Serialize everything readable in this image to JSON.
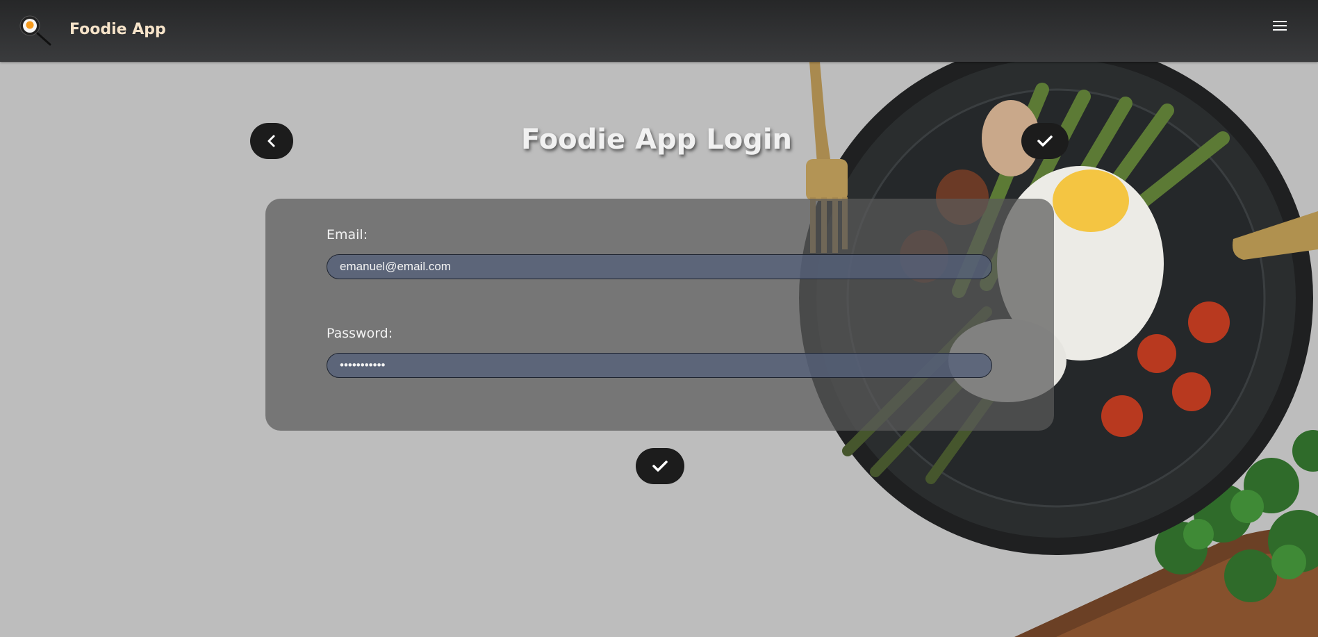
{
  "navbar": {
    "brand": "Foodie App",
    "logo_icon": "frying-pan-egg-icon",
    "menu_icon": "hamburger-menu-icon"
  },
  "page": {
    "title": "Foodie App Login"
  },
  "buttons": {
    "back_icon": "chevron-left-icon",
    "confirm_icon": "checkmark-icon",
    "submit_icon": "checkmark-icon"
  },
  "form": {
    "email_label": "Email:",
    "email_value": "emanuel@email.com",
    "password_label": "Password:",
    "password_value": "•••••••••••"
  },
  "colors": {
    "background": "#bdbdbd",
    "navbar": "#2e2f31",
    "brand_text": "#f6e3c9",
    "button": "#1c1c1c",
    "input": "#54607a"
  }
}
